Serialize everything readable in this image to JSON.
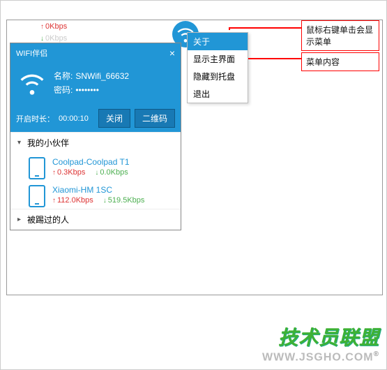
{
  "tray": {
    "upload": "0Kbps",
    "download": "0Kbps"
  },
  "menu": {
    "items": [
      {
        "label": "关于"
      },
      {
        "label": "显示主界面"
      },
      {
        "label": "隐藏到托盘"
      },
      {
        "label": "退出"
      }
    ]
  },
  "annotations": {
    "a1": "鼠标右键单击会显示菜单",
    "a2": "菜单内容"
  },
  "app": {
    "title": "WIFI伴侣",
    "name_label": "名称:",
    "name_value": "SNWifi_66632",
    "pwd_label": "密码:",
    "pwd_value": "••••••••",
    "uptime_label": "开启时长：",
    "uptime_value": "00:00:10",
    "close_btn": "关闭",
    "qr_btn": "二维码",
    "section_partners": "我的小伙伴",
    "section_kicked": "被踢过的人",
    "devices": [
      {
        "name": "Coolpad-Coolpad T1",
        "up": "0.3Kbps",
        "down": "0.0Kbps"
      },
      {
        "name": "Xiaomi-HM 1SC",
        "up": "112.0Kbps",
        "down": "519.5Kbps"
      }
    ]
  },
  "footer": {
    "brand": "技术员联盟",
    "url": "WWW.JSGHO.COM"
  }
}
